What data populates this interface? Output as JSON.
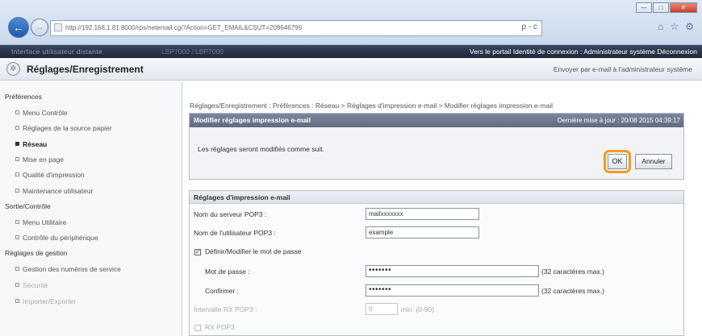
{
  "browser": {
    "url": "http://192.168.1.81:8000/rps/netemail.cgi?Action=GET_EMAIL&CSUT=209646799",
    "address_tools": "ρ - c",
    "window_buttons": [
      "—",
      "□",
      "✕"
    ],
    "tab_icons": [
      "⌂",
      "☆",
      "⚙"
    ]
  },
  "topbar": {
    "product_name": "Interface utilisateur distante",
    "device_name": "LBP7000 / LBP7000",
    "links_text": "Vers le portail  Identité de connexion : Administrateur système  Déconnexion"
  },
  "header": {
    "title": "Réglages/Enregistrement",
    "email_admin_link": "Envoyer par e-mail à l'administrateur système"
  },
  "sidebar": {
    "sections": [
      {
        "label": "Préférences"
      },
      {
        "label": "Sortie/Contrôle"
      },
      {
        "label": "Réglages de gestion"
      }
    ],
    "items": [
      {
        "label": "Menu Contrôle"
      },
      {
        "label": "Réglages de la source papier"
      },
      {
        "label": "Réseau"
      },
      {
        "label": "Mise en page"
      },
      {
        "label": "Qualité d'impression"
      },
      {
        "label": "Maintenance utilisateur"
      },
      {
        "label": "Menu Utilitaire"
      },
      {
        "label": "Contrôle du périphérique"
      },
      {
        "label": "Gestion des numéros de service"
      },
      {
        "label": "Sécurité"
      },
      {
        "label": "Importer/Exporter"
      }
    ]
  },
  "breadcrumb": "Réglages/Enregistrement : Préférences : Réseau > Réglages d'impression e-mail > Modifier réglages impression e-mail",
  "confirm_panel": {
    "title": "Modifier réglages impression e-mail",
    "last_update": "Dernière mise à jour : 20/08 2015 04:39:17",
    "message": "Les réglages seront modifiés comme suit.",
    "ok_label": "OK",
    "cancel_label": "Annuler"
  },
  "settings_panel": {
    "title": "Réglages d'impression e-mail",
    "pop3_server_label": "Nom du serveur POP3 :",
    "pop3_server_value": "mailxxxxxxx",
    "pop3_user_label": "Nom de l'utilisateur POP3 :",
    "pop3_user_value": "example",
    "set_password_checkbox": "✓",
    "set_password_label": "Définir/Modifier le mot de passe",
    "password_label": "Mot de passe :",
    "password_value": "•••••••",
    "password_hint": "(32 caractères max.)",
    "confirm_label": "Confirmer :",
    "confirm_value": "•••••••",
    "confirm_hint": "(32 caractères max.)",
    "interval_label": "Intervalle RX POP3 :",
    "interval_value": "0",
    "interval_hint": "min. (0-90)",
    "rx_pop3_label": "RX POP3"
  }
}
